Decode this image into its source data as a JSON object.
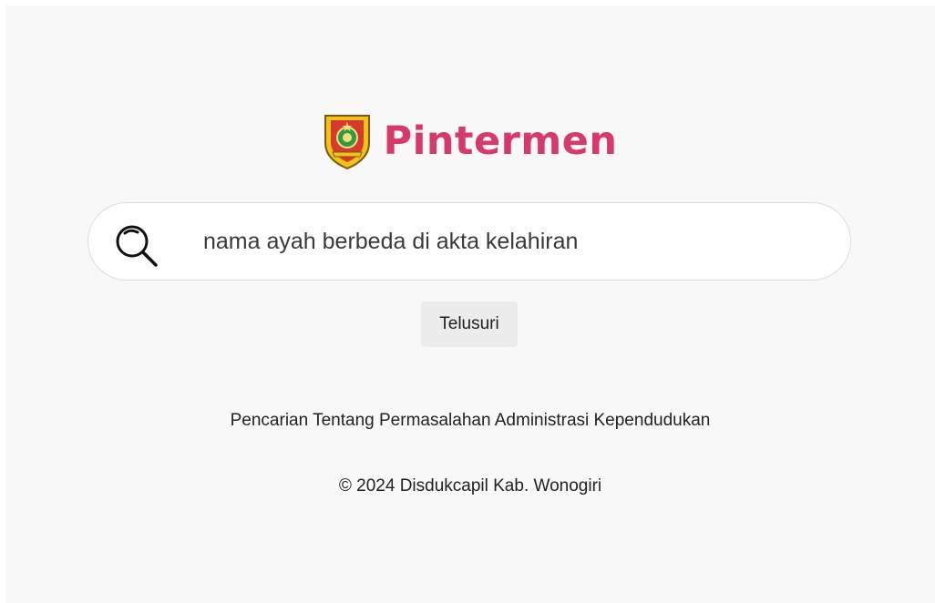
{
  "brand": {
    "name": "Pintermen",
    "color": "#d6396a",
    "emblem_icon": "wonogiri-regency-emblem-icon"
  },
  "search": {
    "icon": "search-icon",
    "value": "nama ayah berbeda di akta kelahiran",
    "button_label": "Telusuri"
  },
  "tagline": "Pencarian Tentang Permasalahan Administrasi Kependudukan",
  "footer": {
    "copyright": "© 2024 Disdukcapil Kab. Wonogiri"
  }
}
